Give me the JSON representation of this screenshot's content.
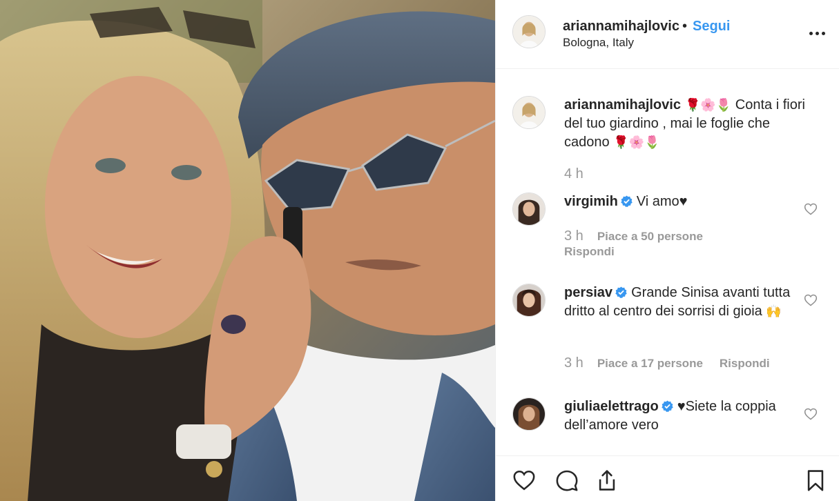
{
  "header": {
    "username": "ariannamihajlovic",
    "separator": "•",
    "follow_label": "Segui",
    "location": "Bologna, Italy"
  },
  "caption": {
    "username": "ariannamihajlovic",
    "emoji_a": "🌹🌸🌷",
    "text": "Conta i fiori del tuo giardino , mai le foglie che cadono",
    "emoji_b": "🌹🌸🌷",
    "time": "4 h"
  },
  "comments": [
    {
      "username": "virgimih",
      "text": "Vi amo♥",
      "time": "3 h",
      "likes": "Piace a 50 persone",
      "reply": "Rispondi"
    },
    {
      "username": "persiav",
      "text": "Grande Sinisa avanti tutta dritto al centro dei sorrisi di gioia",
      "emoji": "🙌",
      "time": "3 h",
      "likes": "Piace a 17 persone",
      "reply": "Rispondi"
    },
    {
      "username": "giuliaelettrago",
      "text": "♥Siete la coppia dell’amore vero"
    }
  ],
  "icons": {
    "more": "more-options-icon",
    "like": "heart-icon",
    "comment": "comment-icon",
    "share": "share-icon",
    "save": "bookmark-icon",
    "verified": "verified-badge-icon"
  },
  "colors": {
    "follow": "#3897f0",
    "verified": "#3897f0",
    "muted": "#999999",
    "text": "#262626"
  }
}
